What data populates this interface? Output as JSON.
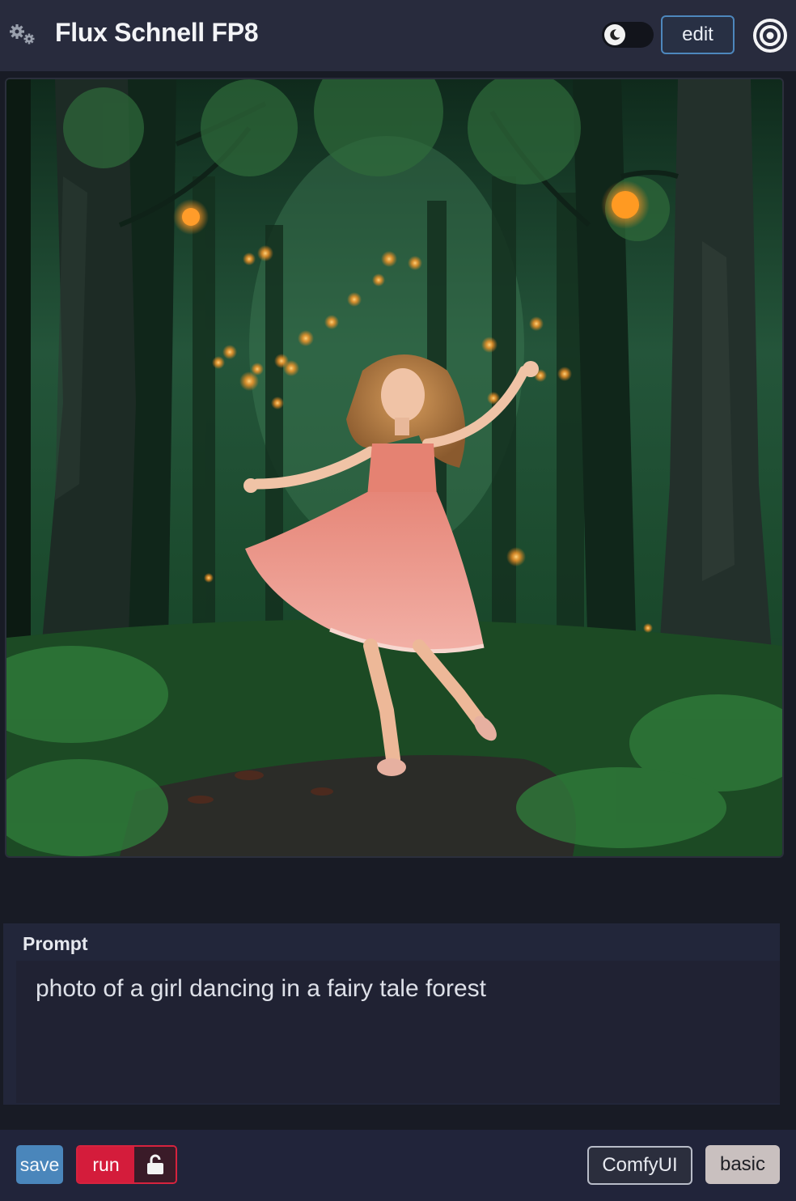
{
  "header": {
    "title": "Flux Schnell FP8",
    "settings_icon": "gears-icon",
    "theme_icon": "moon-icon",
    "edit_label": "edit",
    "menu_icon": "target-icon"
  },
  "image": {
    "icon": "generated-image"
  },
  "prompt": {
    "label": "Prompt",
    "value": "photo of a girl dancing in a fairy tale forest"
  },
  "footer": {
    "save_label": "save",
    "run_label": "run",
    "lock_icon": "unlock-icon",
    "comfyui_label": "ComfyUI",
    "basic_label": "basic"
  },
  "colors": {
    "header_bg": "#282b3d",
    "page_bg": "#181b25",
    "save": "#4a86bb",
    "run": "#d41c3b",
    "edit_border": "#4d87bd",
    "basic_bg": "#c9c0bf"
  }
}
